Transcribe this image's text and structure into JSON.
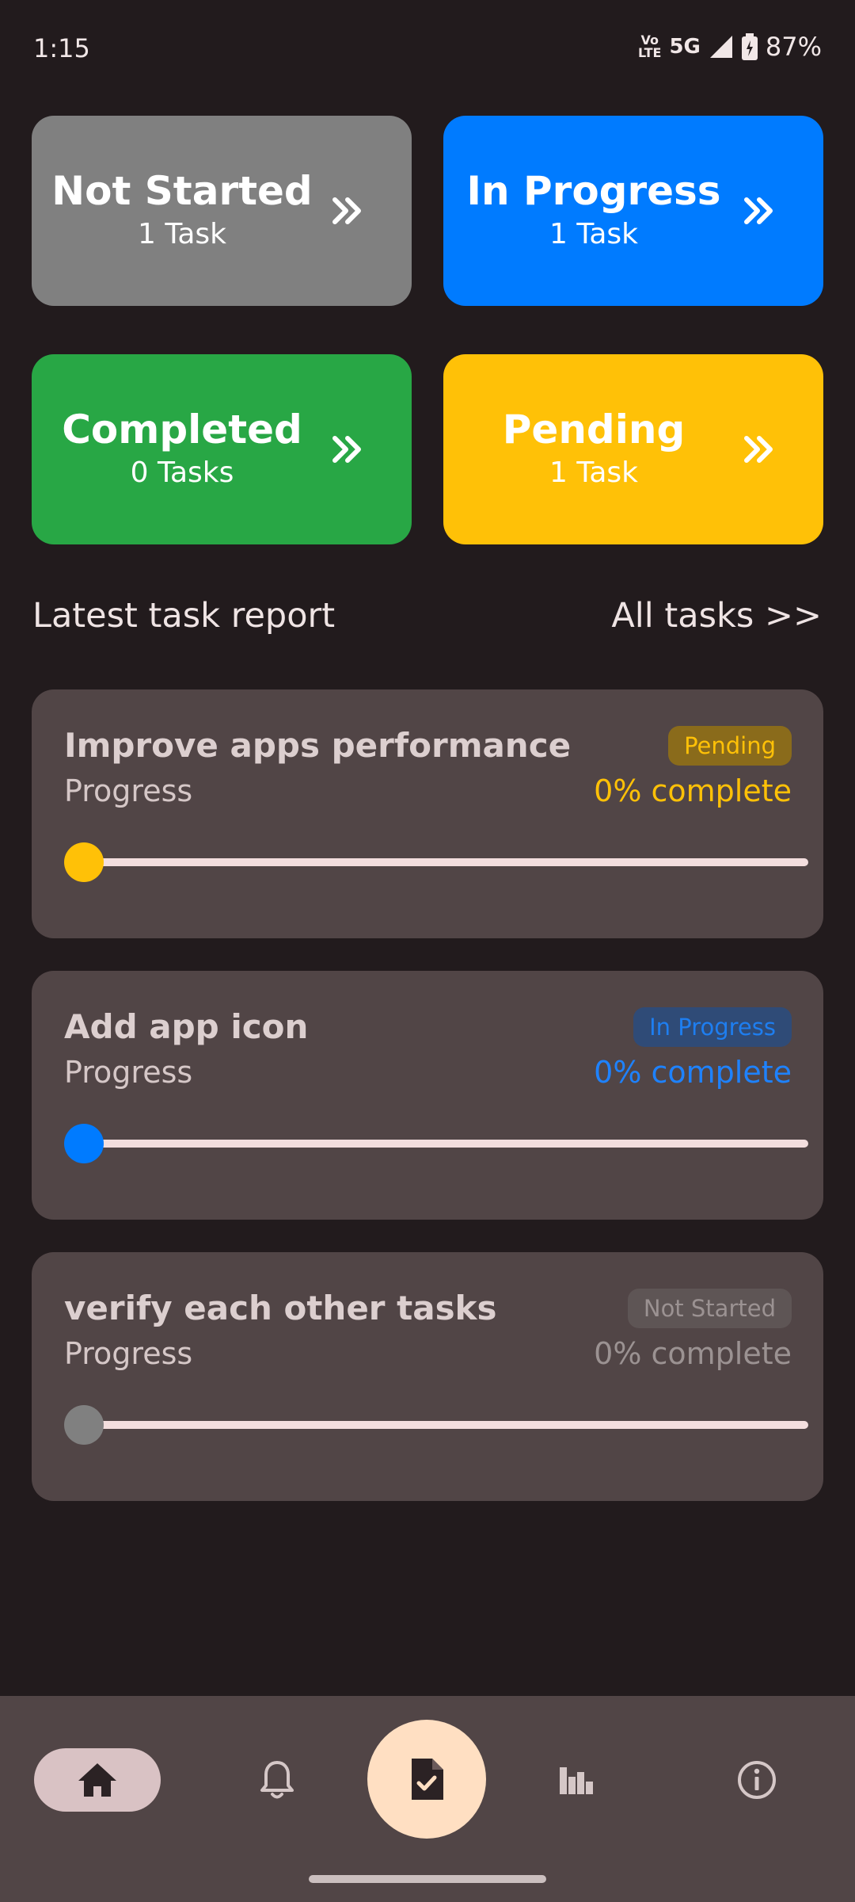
{
  "status_bar": {
    "time": "1:15",
    "volte_top": "Vo",
    "volte_bottom": "LTE",
    "network": "5G",
    "battery": "87%"
  },
  "categories": [
    {
      "title": "Not Started",
      "count": "1 Task",
      "color": "#808080"
    },
    {
      "title": "In Progress",
      "count": "1 Task",
      "color": "#007bff"
    },
    {
      "title": "Completed",
      "count": "0 Tasks",
      "color": "#28a745"
    },
    {
      "title": "Pending",
      "count": "1 Task",
      "color": "#ffc107"
    }
  ],
  "section": {
    "title": "Latest task report",
    "all_tasks_link": "All tasks >>"
  },
  "tasks": [
    {
      "title": "Improve apps performance",
      "status": "Pending",
      "progress_label": "Progress",
      "progress_text": "0% complete",
      "progress_value": 0
    },
    {
      "title": "Add app icon",
      "status": "In Progress",
      "progress_label": "Progress",
      "progress_text": "0% complete",
      "progress_value": 0
    },
    {
      "title": "verify each other tasks",
      "status": "Not Started",
      "progress_label": "Progress",
      "progress_text": "0% complete",
      "progress_value": 0
    }
  ],
  "bottom_nav": {
    "items": [
      "home-icon",
      "bell-icon",
      "task-document-icon",
      "chart-icon",
      "info-icon"
    ],
    "active": "home-icon"
  },
  "colors": {
    "background": "#221b1d",
    "card_surface": "#514546",
    "fab": "#ffdfc2"
  }
}
